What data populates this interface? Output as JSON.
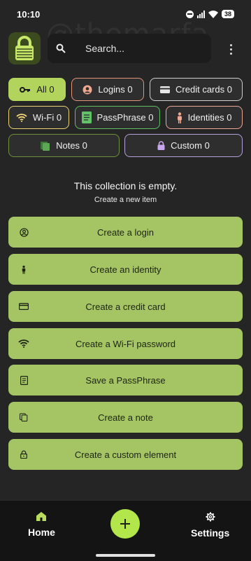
{
  "status": {
    "time": "10:10",
    "battery": "38"
  },
  "watermark": "@themarfa",
  "search": {
    "placeholder": "Search..."
  },
  "filters": [
    {
      "label": "All 0",
      "icon": "key-icon",
      "active": true
    },
    {
      "label": "Logins 0",
      "icon": "user-circle-icon"
    },
    {
      "label": "Credit cards 0",
      "icon": "credit-card-icon"
    },
    {
      "label": "Wi-Fi 0",
      "icon": "wifi-icon"
    },
    {
      "label": "PassPhrase 0",
      "icon": "document-icon"
    },
    {
      "label": "Identities 0",
      "icon": "person-icon"
    },
    {
      "label": "Notes 0",
      "icon": "notes-icon"
    },
    {
      "label": "Custom 0",
      "icon": "lock-icon"
    }
  ],
  "empty": {
    "title": "This collection is empty.",
    "subtitle": "Create a new item"
  },
  "actions": [
    {
      "label": "Create a login",
      "icon": "user-circle-icon"
    },
    {
      "label": "Create an identity",
      "icon": "person-icon"
    },
    {
      "label": "Create a credit card",
      "icon": "credit-card-icon"
    },
    {
      "label": "Create a Wi-Fi password",
      "icon": "wifi-icon"
    },
    {
      "label": "Save a PassPhrase",
      "icon": "document-icon"
    },
    {
      "label": "Create a note",
      "icon": "notes-icon"
    },
    {
      "label": "Create a custom element",
      "icon": "lock-icon"
    }
  ],
  "nav": {
    "home": "Home",
    "settings": "Settings"
  },
  "colors": {
    "accent": "#b2d45c",
    "action_bg": "#a5c564",
    "fab": "#b3e64a",
    "background": "#252525"
  }
}
